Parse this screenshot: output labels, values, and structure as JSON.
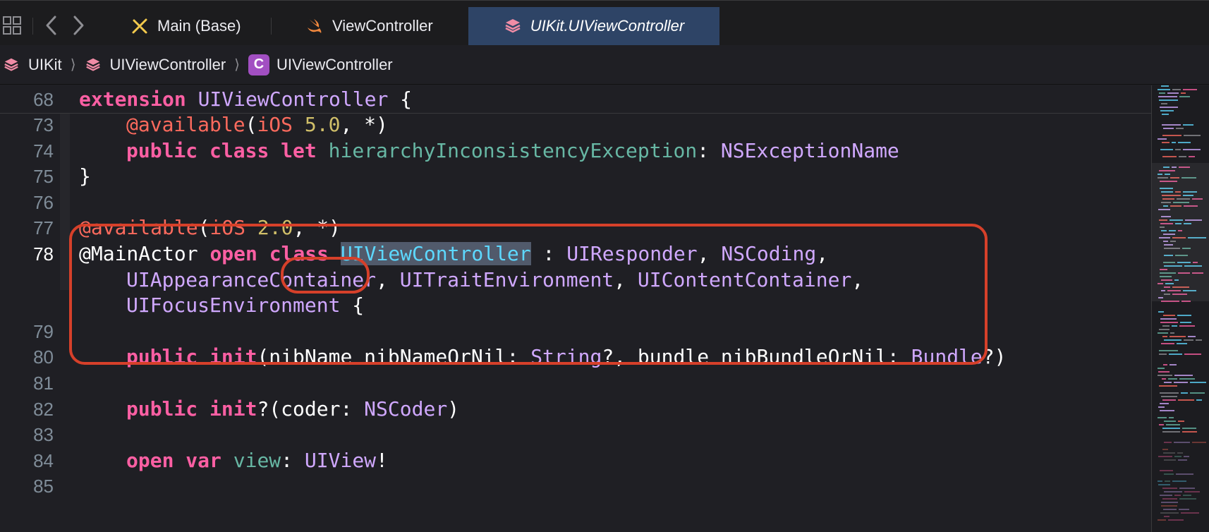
{
  "toolbar": {
    "grid_icon": "grid-icon",
    "back_icon": "chevron-left-icon",
    "forward_icon": "chevron-right-icon"
  },
  "tabs": [
    {
      "label": "Main (Base)",
      "icon": "interface-builder-icon",
      "active": false
    },
    {
      "label": "ViewController",
      "icon": "swift-icon",
      "active": false
    },
    {
      "label": "UIKit.UIViewController",
      "icon": "module-icon",
      "active": true
    }
  ],
  "breadcrumb": {
    "items": [
      {
        "label": "UIKit",
        "icon": "module-icon"
      },
      {
        "label": "UIViewController",
        "icon": "module-icon"
      },
      {
        "label": "UIViewController",
        "icon": "class-icon",
        "badge": "C"
      }
    ],
    "separator": "⟩"
  },
  "editor": {
    "sticky": {
      "number": "68",
      "tokens": [
        {
          "t": "extension",
          "c": "kw"
        },
        {
          "t": " UIViewController ",
          "c": "typ"
        },
        {
          "t": "{",
          "c": "plain"
        }
      ]
    },
    "lines": [
      {
        "number": "73",
        "indent": 1,
        "tokens": [
          {
            "t": "@available",
            "c": "attr"
          },
          {
            "t": "(",
            "c": "plain"
          },
          {
            "t": "iOS",
            "c": "attr"
          },
          {
            "t": " ",
            "c": "plain"
          },
          {
            "t": "5.0",
            "c": "num"
          },
          {
            "t": ", *)",
            "c": "plain"
          }
        ]
      },
      {
        "number": "74",
        "indent": 1,
        "tokens": [
          {
            "t": "public",
            "c": "kw"
          },
          {
            "t": " ",
            "c": "plain"
          },
          {
            "t": "class",
            "c": "kw"
          },
          {
            "t": " ",
            "c": "plain"
          },
          {
            "t": "let",
            "c": "kw"
          },
          {
            "t": " ",
            "c": "plain"
          },
          {
            "t": "hierarchyInconsistencyException",
            "c": "prop"
          },
          {
            "t": ": ",
            "c": "plain"
          },
          {
            "t": "NSExceptionName",
            "c": "typ"
          }
        ]
      },
      {
        "number": "75",
        "indent": 0,
        "tokens": [
          {
            "t": "}",
            "c": "plain"
          }
        ]
      },
      {
        "number": "76",
        "indent": 0,
        "tokens": []
      },
      {
        "number": "77",
        "indent": 0,
        "tokens": [
          {
            "t": "@available",
            "c": "attr"
          },
          {
            "t": "(",
            "c": "plain"
          },
          {
            "t": "iOS",
            "c": "attr"
          },
          {
            "t": " ",
            "c": "plain"
          },
          {
            "t": "2.0",
            "c": "num"
          },
          {
            "t": ", *)",
            "c": "plain"
          }
        ]
      },
      {
        "number": "78",
        "indent": 0,
        "current": true,
        "tokens": [
          {
            "t": "@MainActor",
            "c": "plain"
          },
          {
            "t": " ",
            "c": "plain"
          },
          {
            "t": "open",
            "c": "kw"
          },
          {
            "t": " ",
            "c": "plain"
          },
          {
            "t": "class",
            "c": "kw"
          },
          {
            "t": " ",
            "c": "plain"
          },
          {
            "t": "UIViewController",
            "c": "decl sel"
          },
          {
            "t": " : ",
            "c": "plain"
          },
          {
            "t": "UIResponder",
            "c": "typ"
          },
          {
            "t": ", ",
            "c": "plain"
          },
          {
            "t": "NSCoding",
            "c": "typ"
          },
          {
            "t": ",",
            "c": "plain"
          }
        ]
      },
      {
        "number": "",
        "indent": 1,
        "tokens": [
          {
            "t": "UIAppearanceContainer",
            "c": "typ"
          },
          {
            "t": ", ",
            "c": "plain"
          },
          {
            "t": "UITraitEnvironment",
            "c": "typ"
          },
          {
            "t": ", ",
            "c": "plain"
          },
          {
            "t": "UIContentContainer",
            "c": "typ"
          },
          {
            "t": ",",
            "c": "plain"
          }
        ]
      },
      {
        "number": "",
        "indent": 1,
        "tokens": [
          {
            "t": "UIFocusEnvironment",
            "c": "typ"
          },
          {
            "t": " {",
            "c": "plain"
          }
        ]
      },
      {
        "number": "79",
        "indent": 0,
        "tokens": []
      },
      {
        "number": "80",
        "indent": 1,
        "tokens": [
          {
            "t": "public",
            "c": "kw"
          },
          {
            "t": " ",
            "c": "plain"
          },
          {
            "t": "init",
            "c": "kw"
          },
          {
            "t": "(nibName nibNameOrNil: ",
            "c": "plain"
          },
          {
            "t": "String",
            "c": "typ"
          },
          {
            "t": "?, bundle nibBundleOrNil: ",
            "c": "plain"
          },
          {
            "t": "Bundle",
            "c": "typ"
          },
          {
            "t": "?)",
            "c": "plain"
          }
        ]
      },
      {
        "number": "81",
        "indent": 0,
        "tokens": []
      },
      {
        "number": "82",
        "indent": 1,
        "tokens": [
          {
            "t": "public",
            "c": "kw"
          },
          {
            "t": " ",
            "c": "plain"
          },
          {
            "t": "init",
            "c": "kw"
          },
          {
            "t": "?(coder: ",
            "c": "plain"
          },
          {
            "t": "NSCoder",
            "c": "typ"
          },
          {
            "t": ")",
            "c": "plain"
          }
        ]
      },
      {
        "number": "83",
        "indent": 0,
        "tokens": []
      },
      {
        "number": "84",
        "indent": 1,
        "tokens": [
          {
            "t": "open",
            "c": "kw"
          },
          {
            "t": " ",
            "c": "plain"
          },
          {
            "t": "var",
            "c": "kw"
          },
          {
            "t": " ",
            "c": "plain"
          },
          {
            "t": "view",
            "c": "prop"
          },
          {
            "t": ": ",
            "c": "plain"
          },
          {
            "t": "UIView",
            "c": "typ"
          },
          {
            "t": "!",
            "c": "plain"
          }
        ]
      },
      {
        "number": "85",
        "indent": 0,
        "tokens": []
      }
    ]
  },
  "colors": {
    "keyword": "#fc5fa3",
    "attribute": "#fc6a5d",
    "type": "#d0a8ff",
    "declaration": "#5dd8ff",
    "property": "#67b7a4",
    "number": "#d0bf69",
    "annotation": "#d6402a",
    "active_tab": "#2e4466"
  }
}
